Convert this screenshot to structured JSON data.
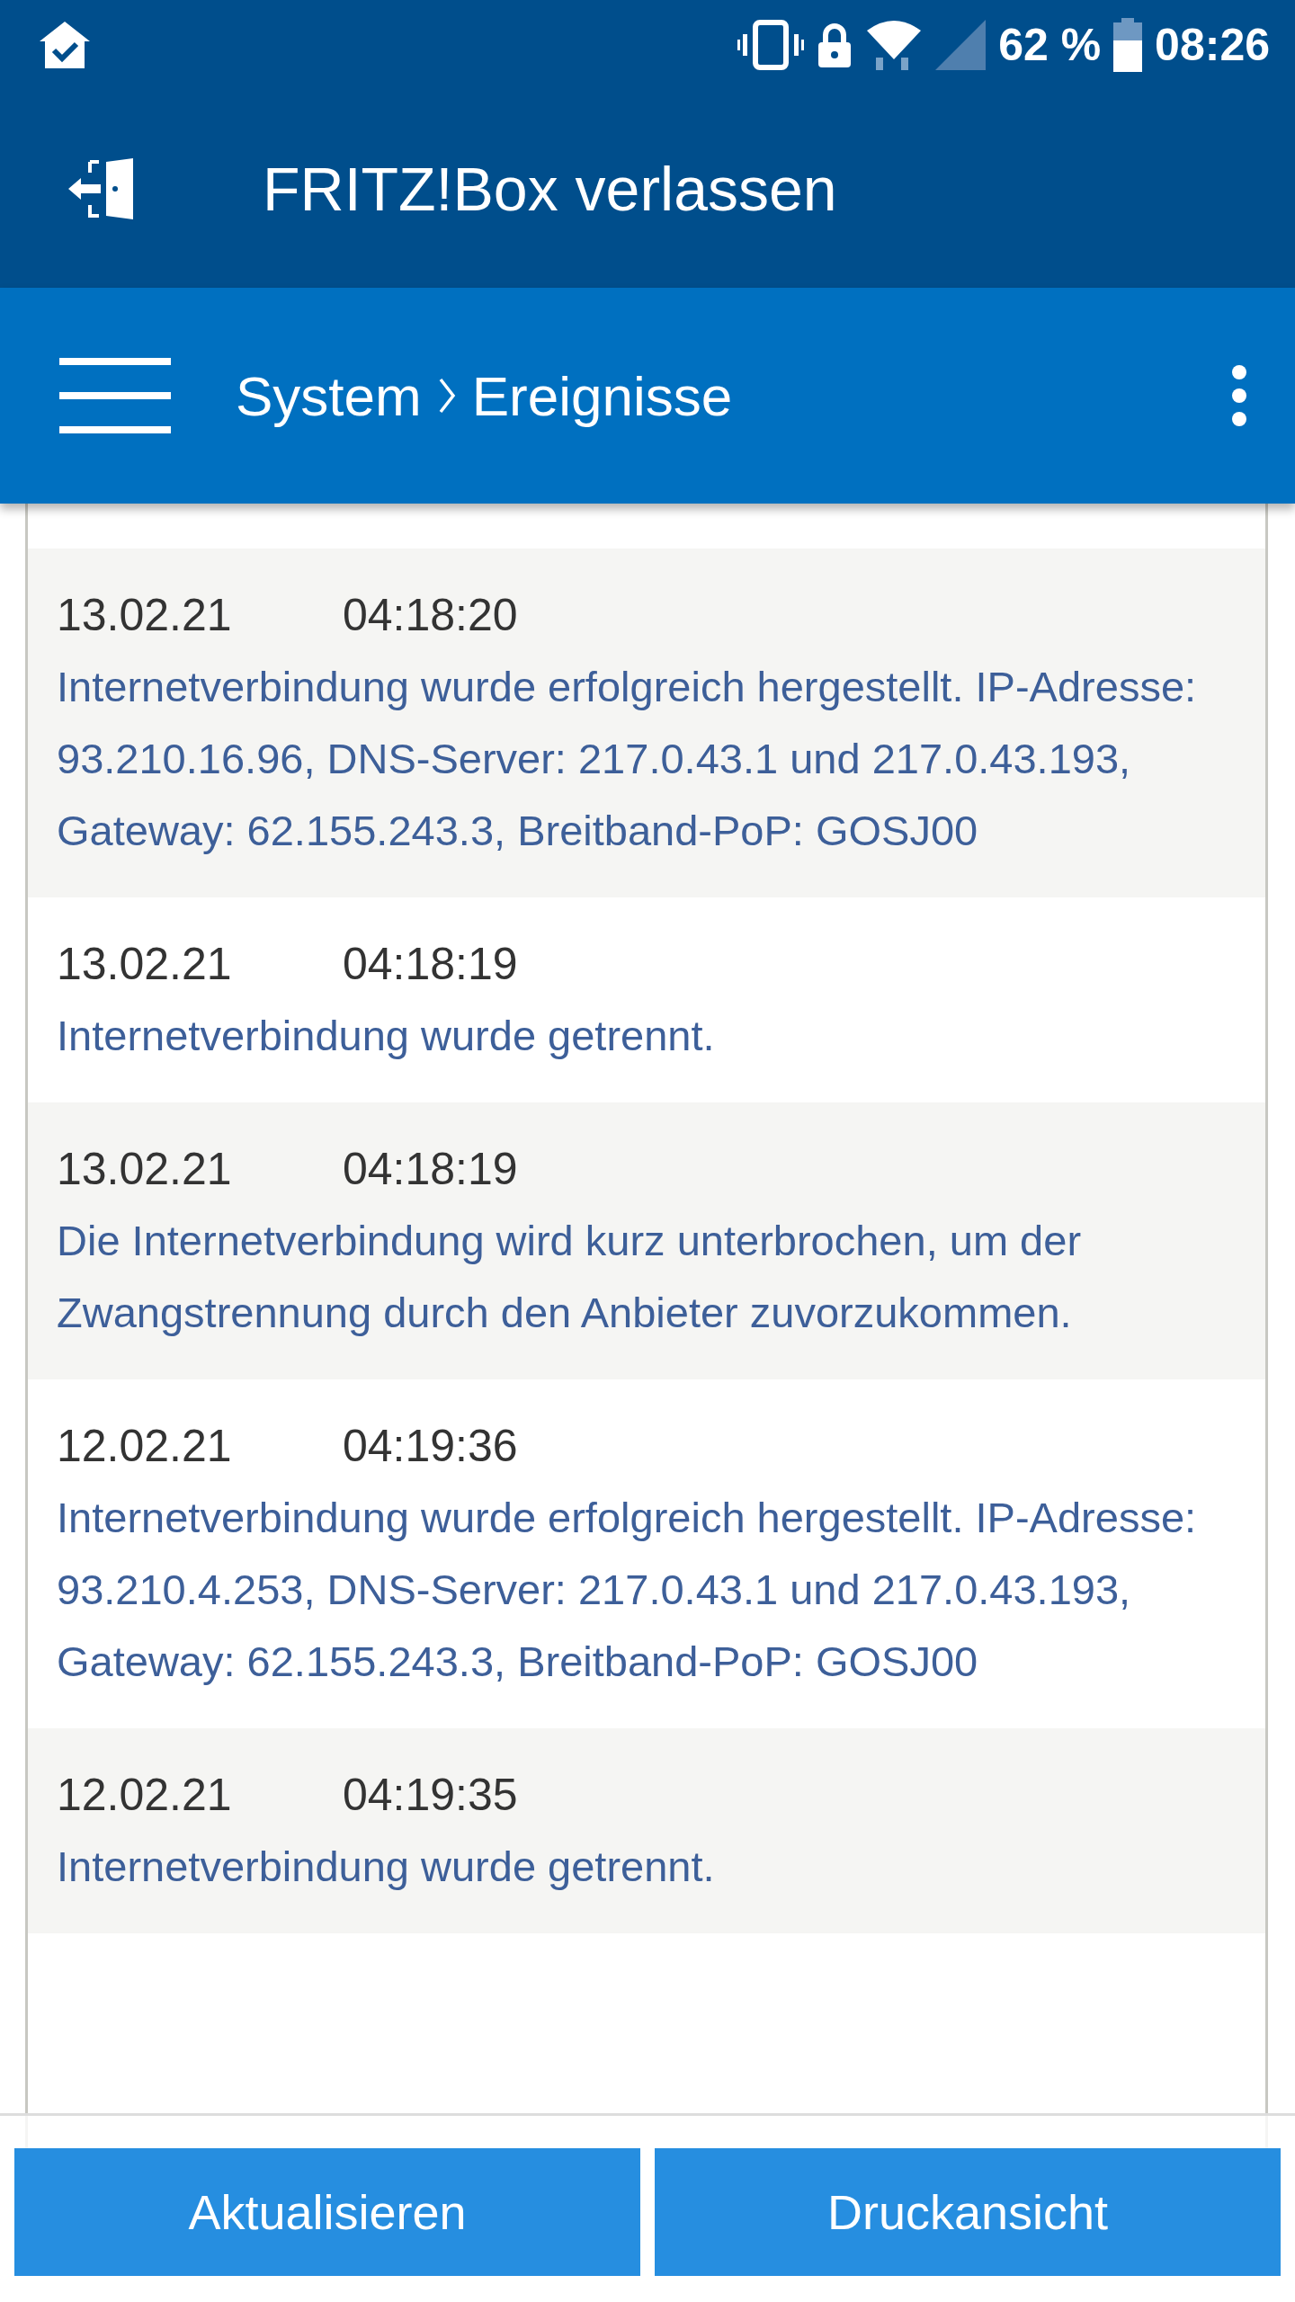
{
  "status_bar": {
    "battery_percent": "62 %",
    "time": "08:26"
  },
  "app_bar": {
    "title": "FRITZ!Box verlassen"
  },
  "toolbar": {
    "breadcrumb": [
      "System",
      "Ereignisse"
    ]
  },
  "events": [
    {
      "kind": "full",
      "date": "13.02.21",
      "time": "04:18:20",
      "message": "Internetverbindung wurde erfolgreich hergestellt. IP-Adresse: 93.210.16.96, DNS-Server: 217.0.43.1 und 217.0.43.193, Gateway: 62.155.243.3, Breitband-PoP: GOSJ00"
    },
    {
      "kind": "full",
      "date": "13.02.21",
      "time": "04:18:19",
      "message": "Internetverbindung wurde getrennt."
    },
    {
      "kind": "full",
      "date": "13.02.21",
      "time": "04:18:19",
      "message": "Die Internetverbindung wird kurz unterbrochen, um der Zwangstrennung durch den Anbieter zuvorzukommen."
    },
    {
      "kind": "full",
      "date": "12.02.21",
      "time": "04:19:36",
      "message": "Internetverbindung wurde erfolgreich hergestellt. IP-Adresse: 93.210.4.253, DNS-Server: 217.0.43.1 und 217.0.43.193, Gateway: 62.155.243.3, Breitband-PoP: GOSJ00"
    },
    {
      "kind": "full",
      "date": "12.02.21",
      "time": "04:19:35",
      "message": "Internetverbindung wurde getrennt."
    }
  ],
  "buttons": [
    "Aktualisieren",
    "Druckansicht"
  ]
}
